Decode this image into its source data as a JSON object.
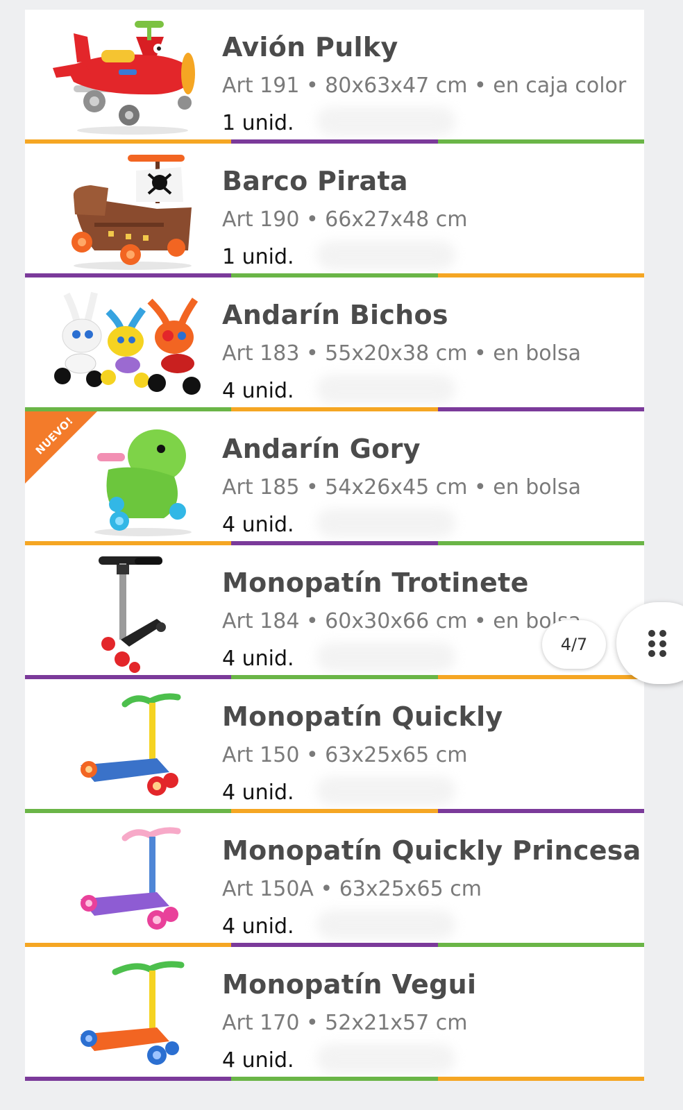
{
  "colors": {
    "orange": "#f5a623",
    "purple": "#7b3a9a",
    "green": "#6ab547",
    "badge": "#f37b2a"
  },
  "products": [
    {
      "name": "Avión Pulky",
      "meta": "Art 191 • 80x63x47 cm • en caja color",
      "qty": "1 unid.",
      "image_icon": "toy-plane-icon",
      "stripe": [
        "#f5a623",
        "#7b3a9a",
        "#6ab547"
      ]
    },
    {
      "name": "Barco Pirata",
      "meta": "Art 190 • 66x27x48 cm",
      "qty": "1 unid.",
      "image_icon": "pirate-ship-icon",
      "stripe": [
        "#7b3a9a",
        "#6ab547",
        "#f5a623"
      ]
    },
    {
      "name": "Andarín Bichos",
      "meta": "Art 183 • 55x20x38 cm • en bolsa",
      "qty": "4 unid.",
      "image_icon": "bug-riders-icon",
      "stripe": [
        "#6ab547",
        "#f5a623",
        "#7b3a9a"
      ]
    },
    {
      "name": "Andarín Gory",
      "meta": "Art 185 • 54x26x45 cm • en bolsa",
      "qty": "4 unid.",
      "image_icon": "dino-rider-icon",
      "badge": "NUEVO!",
      "stripe": [
        "#f5a623",
        "#7b3a9a",
        "#6ab547"
      ]
    },
    {
      "name": "Monopatín Trotinete",
      "meta": "Art 184 • 60x30x66 cm • en bolsa",
      "qty": "4 unid.",
      "image_icon": "black-scooter-icon",
      "stripe": [
        "#7b3a9a",
        "#6ab547",
        "#f5a623"
      ]
    },
    {
      "name": "Monopatín Quickly",
      "meta": "Art 150 • 63x25x65 cm",
      "qty": "4 unid.",
      "image_icon": "blue-scooter-icon",
      "stripe": [
        "#6ab547",
        "#f5a623",
        "#7b3a9a"
      ]
    },
    {
      "name": "Monopatín Quickly Princesa",
      "meta": "Art 150A • 63x25x65 cm",
      "qty": "4 unid.",
      "image_icon": "purple-scooter-icon",
      "stripe": [
        "#f5a623",
        "#7b3a9a",
        "#6ab547"
      ]
    },
    {
      "name": "Monopatín Vegui",
      "meta": "Art 170 • 52x21x57 cm",
      "qty": "4 unid.",
      "image_icon": "orange-scooter-icon",
      "stripe": [
        "#7b3a9a",
        "#6ab547",
        "#f5a623"
      ]
    }
  ],
  "pager": {
    "label": "4/7"
  },
  "menu_button": {
    "icon": "grid-dots-icon"
  }
}
